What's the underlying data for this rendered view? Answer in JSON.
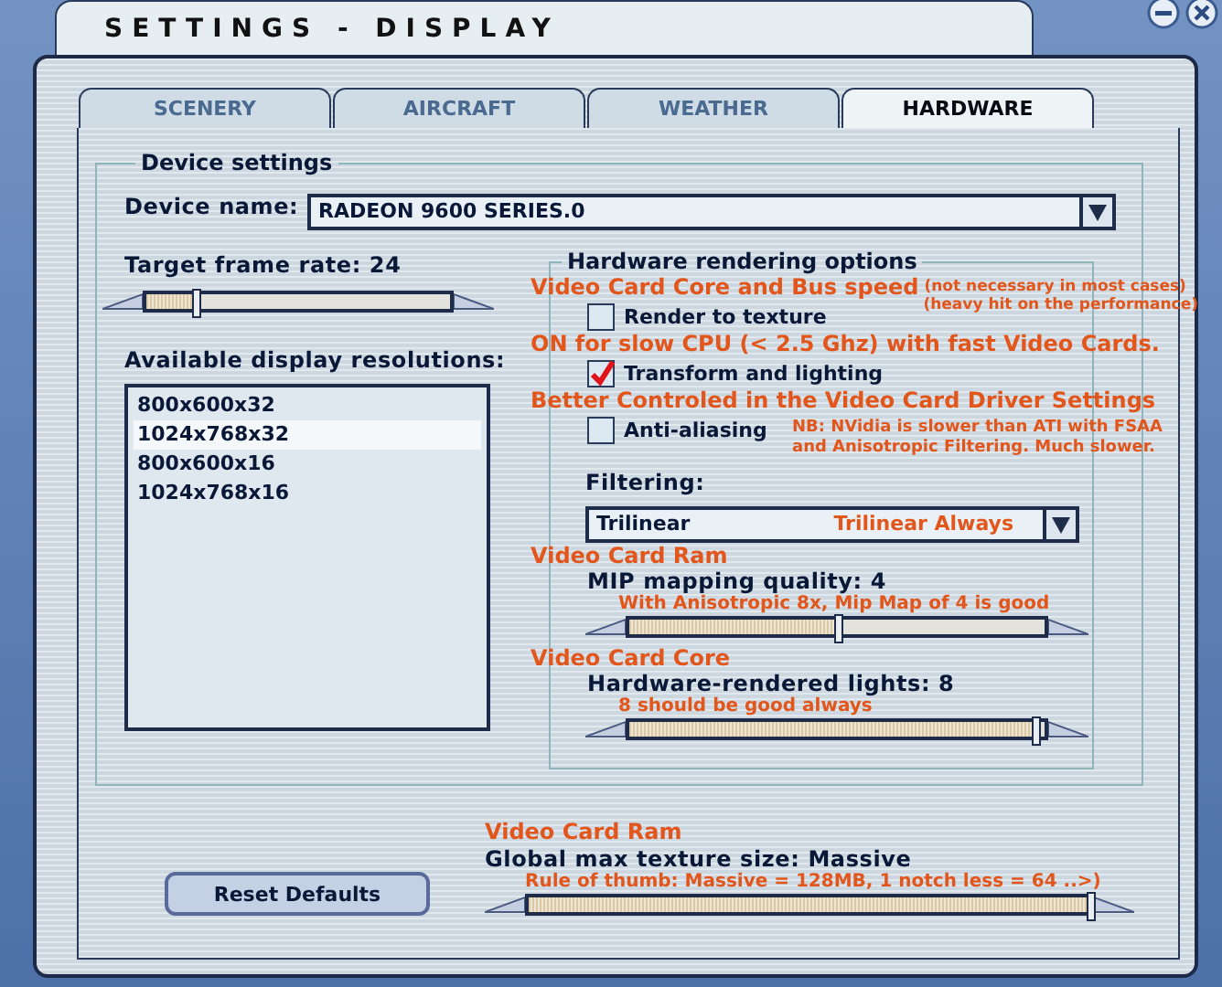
{
  "window": {
    "title": "SETTINGS - DISPLAY"
  },
  "tabs": [
    {
      "label": "SCENERY",
      "selected": false
    },
    {
      "label": "AIRCRAFT",
      "selected": false
    },
    {
      "label": "WEATHER",
      "selected": false
    },
    {
      "label": "HARDWARE",
      "selected": true
    }
  ],
  "device_settings": {
    "title": "Device settings",
    "device_name": {
      "label": "Device name:",
      "value": "RADEON 9600 SERIES.0"
    },
    "frame_rate": {
      "label": "Target frame rate: 24",
      "level": 0.16
    },
    "resolutions": {
      "label": "Available display resolutions:",
      "items": [
        {
          "text": "800x600x32",
          "selected": false
        },
        {
          "text": "1024x768x32",
          "selected": true
        },
        {
          "text": "800x600x16",
          "selected": false
        },
        {
          "text": "1024x768x16",
          "selected": false
        }
      ]
    },
    "hardware_rendering": {
      "title": "Hardware rendering options",
      "items": [
        {
          "kind": "note",
          "text": "Video Card Core and Bus speed",
          "aside": "(not necessary in most cases)"
        },
        {
          "kind": "checkbox",
          "label": "Render to texture",
          "checked": false,
          "note": "(heavy hit on the performance)"
        },
        {
          "kind": "note",
          "text": "ON for slow CPU (< 2.5 Ghz) with fast Video Cards."
        },
        {
          "kind": "checkbox",
          "label": "Transform and lighting",
          "checked": true
        },
        {
          "kind": "note",
          "text": "Better Controled in the Video Card Driver Settings"
        },
        {
          "kind": "checkbox",
          "label": "Anti-aliasing",
          "checked": false,
          "note": "NB: NVidia is slower than ATI with FSAA\nand Anisotropic Filtering. Much slower."
        },
        {
          "kind": "label",
          "text": "Filtering:"
        },
        {
          "kind": "dropdown",
          "value": "Trilinear",
          "note": "Trilinear Always"
        },
        {
          "kind": "note",
          "text": "Video Card Ram"
        },
        {
          "kind": "slider",
          "label": "MIP mapping quality: 4",
          "note": "With Anisotropic 8x, Mip Map of 4 is good",
          "level": 0.5
        },
        {
          "kind": "note",
          "text": "Video Card Core"
        },
        {
          "kind": "slider",
          "label": "Hardware-rendered lights: 8",
          "note": "8 should be good always",
          "level": 0.98
        }
      ]
    }
  },
  "reset_button": "Reset Defaults",
  "texture_size": {
    "heading": "Video Card Ram",
    "label": "Global max texture size: Massive",
    "note": "Rule of thumb: Massive = 128MB, 1 notch less = 64 ..>)",
    "level": 1.0
  }
}
